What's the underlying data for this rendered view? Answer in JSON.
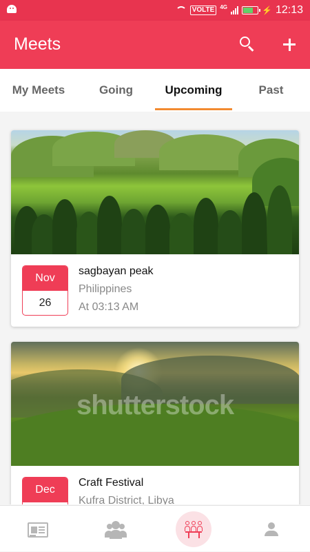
{
  "status_bar": {
    "network_badge": "VOLTE",
    "network_type": "4G",
    "time": "12:13",
    "battery_level": 0.75,
    "battery_color": "#62d16a"
  },
  "app_bar": {
    "title": "Meets",
    "background": "#ef3d56",
    "actions": [
      "search-icon",
      "plus-icon"
    ]
  },
  "tabs": [
    {
      "label": "My Meets",
      "active": false
    },
    {
      "label": "Going",
      "active": false
    },
    {
      "label": "Upcoming",
      "active": true
    },
    {
      "label": "Past",
      "active": false
    }
  ],
  "tab_indicator_color": "#f28a30",
  "meets": [
    {
      "month": "Nov",
      "day": "26",
      "title": "sagbayan peak",
      "location": "Philippines",
      "time": "At 03:13 AM",
      "image": "green hills with palm trees"
    },
    {
      "month": "Dec",
      "day": "",
      "title": "Craft Festival",
      "location": "Kufra District, Libya",
      "time": "",
      "image": "sunset over grassy mountain meadow",
      "watermark": "shutterstock"
    }
  ],
  "bottom_nav": [
    {
      "icon": "newspaper-icon",
      "active": false
    },
    {
      "icon": "group-icon",
      "active": false
    },
    {
      "icon": "meetup-icon",
      "active": true
    },
    {
      "icon": "person-icon",
      "active": false
    }
  ]
}
